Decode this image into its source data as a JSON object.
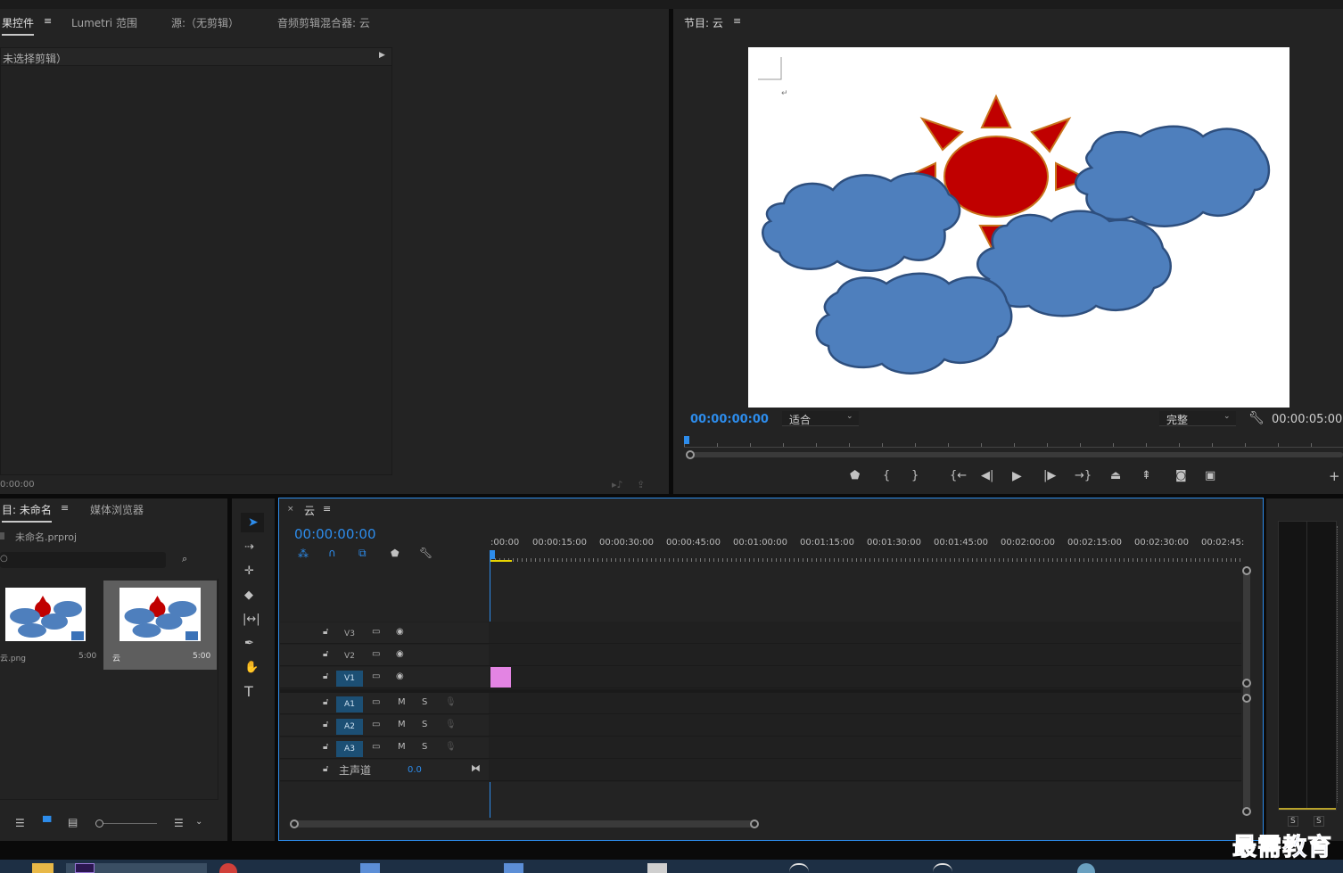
{
  "effect_panel": {
    "tabs": [
      "果控件",
      "Lumetri 范围",
      "源:（无剪辑）",
      "音频剪辑混合器: 云"
    ],
    "no_clip_text": "未选择剪辑）",
    "timecode": "0:00:00"
  },
  "program_monitor": {
    "tab": "节目: 云",
    "timecode": "00:00:00:00",
    "fit_select": "适合",
    "quality_select": "完整",
    "duration": "00:00:05:00"
  },
  "project_panel": {
    "tabs": [
      "目: 未命名",
      "媒体浏览器"
    ],
    "project_file": "未命名.prproj",
    "items": [
      {
        "name": "云.png",
        "duration": "5:00"
      },
      {
        "name": "云",
        "duration": "5:00"
      }
    ]
  },
  "timeline": {
    "tab": "云",
    "timecode": "00:00:00:00",
    "ruler": [
      ":00:00",
      "00:00:15:00",
      "00:00:30:00",
      "00:00:45:00",
      "00:01:00:00",
      "00:01:15:00",
      "00:01:30:00",
      "00:01:45:00",
      "00:02:00:00",
      "00:02:15:00",
      "00:02:30:00",
      "00:02:45:"
    ],
    "video_tracks": [
      "V3",
      "V2",
      "V1"
    ],
    "audio_tracks": [
      "A1",
      "A2",
      "A3"
    ],
    "mute_label": "M",
    "solo_label": "S",
    "master_label": "主声道",
    "master_value": "0.0"
  },
  "meter": {
    "solo": [
      "S",
      "S"
    ]
  },
  "watermark": "最需教育",
  "colors": {
    "accent_blue": "#2d8ceb",
    "clip_pink": "#e384e3",
    "panel_bg": "#232323",
    "playhead": "#2d8ceb"
  }
}
